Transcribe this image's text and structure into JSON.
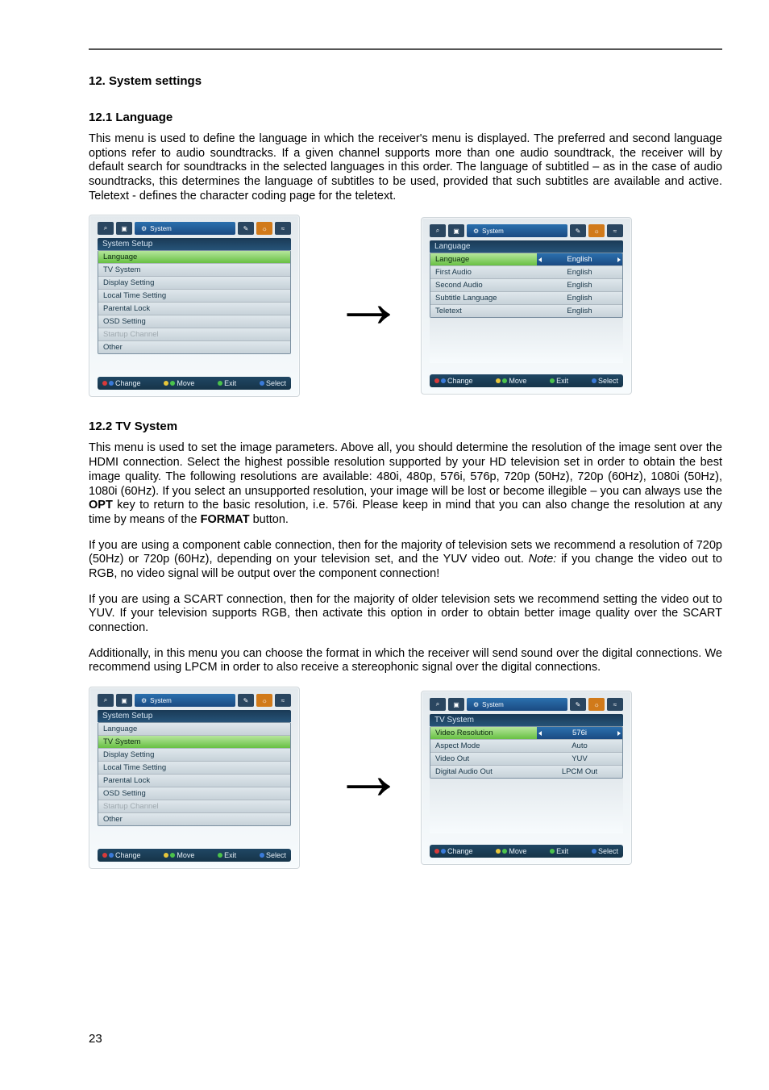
{
  "page_number": "23",
  "headings": {
    "h12": "12. System settings",
    "h12_1": "12.1 Language",
    "h12_2": "12.2 TV System"
  },
  "paragraphs": {
    "p_lang": "This menu is used to define the language in which the receiver's menu is displayed. The preferred and second language options refer to audio soundtracks. If a given channel supports more than one audio soundtrack, the receiver will by default search for soundtracks in the selected languages in this order. The language of subtitled – as in the case of audio soundtracks, this determines the language of subtitles to be used, provided that such subtitles are available and active. Teletext - defines the character coding page for the teletext.",
    "p_tv_1_a": "This menu is used to set the image parameters. Above all, you should determine the resolution of the image sent over the HDMI connection. Select the highest possible resolution supported by your HD television set in order to obtain the best image quality. The following resolutions are available: 480i, 480p, 576i, 576p, 720p (50Hz), 720p (60Hz), 1080i (50Hz), 1080i (60Hz). If you select an unsupported resolution, your image will be lost or become illegible – you can always use the ",
    "p_tv_1_opt": "OPT",
    "p_tv_1_b": " key to return to the basic resolution, i.e. 576i. Please keep in mind that you can also change the resolution at any time by means of the ",
    "p_tv_1_format": "FORMAT",
    "p_tv_1_c": " button.",
    "p_tv_2_a": "If you are using a component cable connection, then for the majority of television sets we recommend a resolution of 720p (50Hz) or 720p (60Hz), depending on your television set, and the YUV video out. ",
    "p_tv_2_note": "Note:",
    "p_tv_2_b": " if you change the video out to RGB, no video signal will be output over the component connection!",
    "p_tv_3": "If you are using a SCART connection, then for the majority of older television sets we recommend setting the video out to YUV. If your television supports RGB, then activate this option in order to obtain better image quality over the SCART connection.",
    "p_tv_4": "Additionally, in this menu you can choose the format in which the receiver will send sound over the digital connections. We recommend using LPCM in order to also receive a stereophonic signal over the digital connections."
  },
  "menu": {
    "top_tab_label": "System",
    "top_icons": {
      "search": "⌕",
      "tv": "▣",
      "gear_small": "⚙",
      "tool": "✎",
      "sun": "☼",
      "wave": "≈"
    },
    "system_setup_title": "System Setup",
    "system_setup_items": [
      "Language",
      "TV System",
      "Display Setting",
      "Local Time Setting",
      "Parental Lock",
      "OSD Setting",
      "Startup Channel",
      "Other"
    ],
    "disabled_item": "Startup Channel",
    "hints": {
      "change": "Change",
      "move": "Move",
      "exit": "Exit",
      "select": "Select"
    }
  },
  "lang_panel": {
    "title": "Language",
    "rows": [
      {
        "key": "Language",
        "val": "English",
        "selected": true
      },
      {
        "key": "First Audio",
        "val": "English"
      },
      {
        "key": "Second Audio",
        "val": "English"
      },
      {
        "key": "Subtitle Language",
        "val": "English"
      },
      {
        "key": "Teletext",
        "val": "English"
      }
    ]
  },
  "tv_panel": {
    "title": "TV System",
    "rows": [
      {
        "key": "Video Resolution",
        "val": "576i",
        "selected": true
      },
      {
        "key": "Aspect Mode",
        "val": "Auto"
      },
      {
        "key": "Video Out",
        "val": "YUV"
      },
      {
        "key": "Digital Audio Out",
        "val": "LPCM Out"
      }
    ]
  }
}
